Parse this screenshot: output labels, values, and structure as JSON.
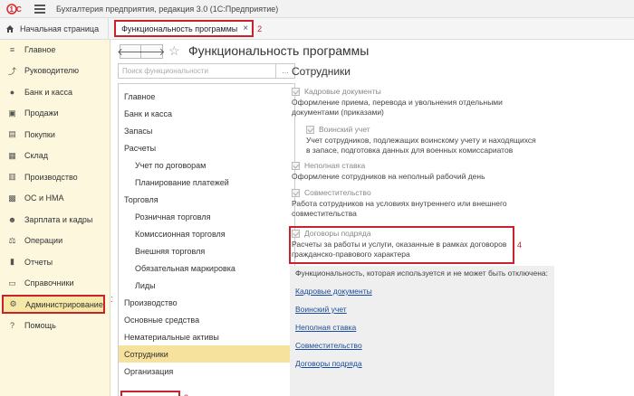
{
  "app": {
    "title": "Бухгалтерия предприятия, редакция 3.0  (1С:Предприятие)"
  },
  "tabs": {
    "home_label": "Начальная страница",
    "active_label": "Функциональность программы",
    "active_close": "×",
    "marker": "2"
  },
  "sidebar": {
    "items": [
      {
        "label": "Главное",
        "icon": "menu-icon"
      },
      {
        "label": "Руководителю",
        "icon": "chart-icon"
      },
      {
        "label": "Банк и касса",
        "icon": "bank-icon"
      },
      {
        "label": "Продажи",
        "icon": "cart-icon"
      },
      {
        "label": "Покупки",
        "icon": "basket-icon"
      },
      {
        "label": "Склад",
        "icon": "warehouse-icon"
      },
      {
        "label": "Производство",
        "icon": "factory-icon"
      },
      {
        "label": "ОС и НМА",
        "icon": "assets-icon"
      },
      {
        "label": "Зарплата и кадры",
        "icon": "people-icon"
      },
      {
        "label": "Операции",
        "icon": "operations-icon"
      },
      {
        "label": "Отчеты",
        "icon": "reports-icon"
      },
      {
        "label": "Справочники",
        "icon": "book-icon"
      },
      {
        "label": "Администрирование",
        "icon": "gear-icon"
      },
      {
        "label": "Помощь",
        "icon": "help-icon"
      }
    ],
    "selected_index": 12,
    "marker": "1"
  },
  "content": {
    "title": "Функциональность программы",
    "back": "🡐",
    "forward": "🡒",
    "star": "☆",
    "search_placeholder": "Поиск функциональности",
    "search_button": "…"
  },
  "nav_list": {
    "items": [
      {
        "label": "Главное",
        "level": 1
      },
      {
        "label": "Банк и касса",
        "level": 1
      },
      {
        "label": "Запасы",
        "level": 1
      },
      {
        "label": "Расчеты",
        "level": 1
      },
      {
        "label": "Учет по договорам",
        "level": 2
      },
      {
        "label": "Планирование платежей",
        "level": 2
      },
      {
        "label": "Торговля",
        "level": 1
      },
      {
        "label": "Розничная торговля",
        "level": 2
      },
      {
        "label": "Комиссионная торговля",
        "level": 2
      },
      {
        "label": "Внешняя торговля",
        "level": 2
      },
      {
        "label": "Обязательная маркировка",
        "level": 2
      },
      {
        "label": "Лиды",
        "level": 2
      },
      {
        "label": "Производство",
        "level": 1
      },
      {
        "label": "Основные средства",
        "level": 1
      },
      {
        "label": "Нематериальные активы",
        "level": 1
      },
      {
        "label": "Сотрудники",
        "level": 1
      },
      {
        "label": "Организация",
        "level": 1
      }
    ],
    "selected_index": 15,
    "marker": "3"
  },
  "section": {
    "title": "Сотрудники",
    "options": [
      {
        "label": "Кадровые документы",
        "desc": [
          "Оформление приема, перевода и увольнения отдельными",
          "документами (приказами)"
        ]
      },
      {
        "label": "Воинский учет",
        "desc": [
          "Учет сотрудников, подлежащих воинскому учету и находящихся",
          "в запасе, подготовка данных для военных комиссариатов"
        ]
      },
      {
        "label": "Неполная ставка",
        "desc": [
          "Оформление сотрудников на неполный рабочий день"
        ]
      },
      {
        "label": "Совместительство",
        "desc": [
          "Работа сотрудников на условиях внутреннего или внешнего",
          "совместительства"
        ]
      },
      {
        "label": "Договоры подряда",
        "desc": [
          "Расчеты за работы и услуги, оказанные в рамках договоров",
          "гражданско-правового характера"
        ]
      }
    ],
    "marker": "4"
  },
  "info": {
    "title": "Функциональность, которая используется и не может быть отключена:",
    "links": [
      "Кадровые документы",
      "Воинский учет",
      "Неполная ставка",
      "Совместительство",
      "Договоры подряда"
    ]
  },
  "colors": {
    "accent_red": "#c8232c",
    "sidebar_bg": "#fcf7dd",
    "selected_bg": "#f6e29c",
    "link": "#1a4c9c"
  }
}
